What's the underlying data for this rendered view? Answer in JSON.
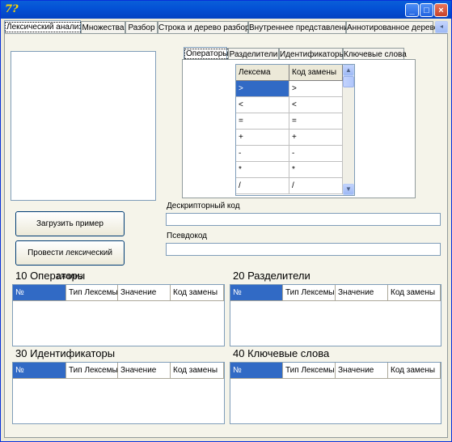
{
  "window": {
    "icon": "app-logo",
    "buttons": [
      "minimize-icon",
      "maximize-icon",
      "close-icon"
    ]
  },
  "main_tabs": [
    "Лексический анализ",
    "Множества",
    "Разбор",
    "Строка и дерево разбора",
    "Внутреннее представление",
    "Аннотированное дерево"
  ],
  "inner_tabs": [
    "Операторы",
    "Разделители",
    "Идентификаторы",
    "Ключевые слова"
  ],
  "lexeme_grid": {
    "headers": [
      "Лексема",
      "Код замены"
    ],
    "rows": [
      [
        ">",
        ">"
      ],
      [
        "<",
        "<"
      ],
      [
        "=",
        "="
      ],
      [
        "+",
        "+"
      ],
      [
        "-",
        "-"
      ],
      [
        "*",
        "*"
      ],
      [
        "/",
        "/"
      ]
    ]
  },
  "buttons": {
    "load_example": "Загрузить пример",
    "run_analysis": "Провести лексический анализ"
  },
  "fields": {
    "descriptor_label": "Дескрипторный код",
    "descriptor_value": "",
    "pseudocode_label": "Псевдокод",
    "pseudocode_value": ""
  },
  "tables": [
    {
      "title": "10 Операторы",
      "columns": [
        "№",
        "Тип Лексемы",
        "Значение",
        "Код замены"
      ]
    },
    {
      "title": "20 Разделители",
      "columns": [
        "№",
        "Тип Лексемы",
        "Значение",
        "Код замены"
      ]
    },
    {
      "title": "30 Идентификаторы",
      "columns": [
        "№",
        "Тип Лексемы",
        "Значение",
        "Код замены"
      ]
    },
    {
      "title": "40 Ключевые слова",
      "columns": [
        "№",
        "Тип Лексемы",
        "Значение",
        "Код замены"
      ]
    }
  ],
  "colors": {
    "title_bar": "#0452d6",
    "selection": "#316ac5",
    "window_bg": "#ece9d8"
  }
}
